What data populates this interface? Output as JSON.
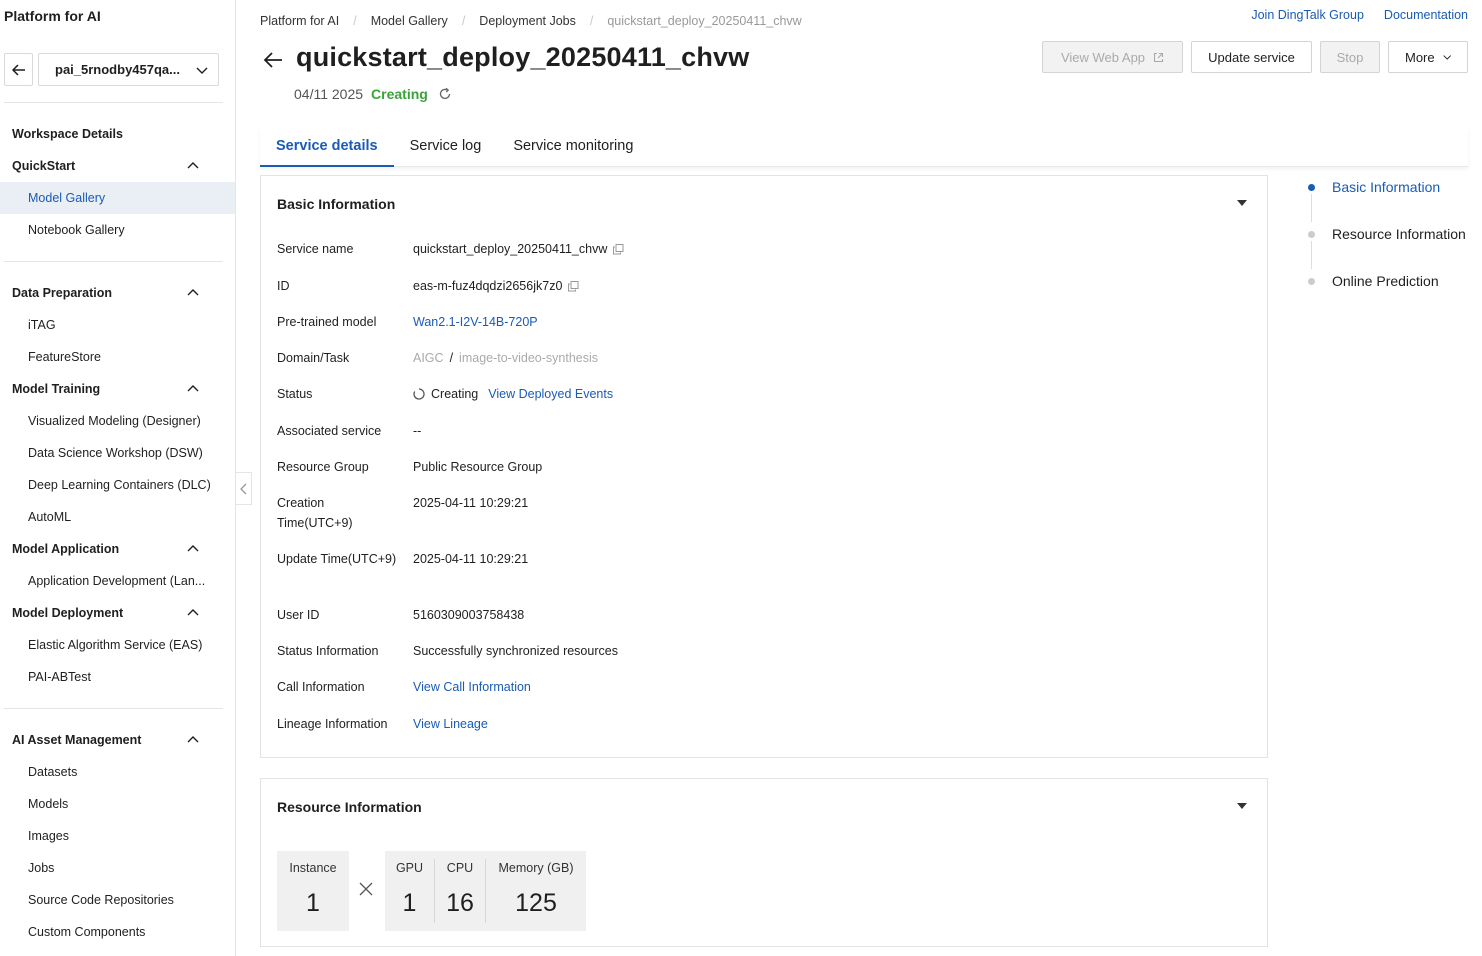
{
  "sidebar": {
    "app_title": "Platform for AI",
    "workspace": "pai_5rnodby457qa...",
    "items": [
      {
        "label": "Workspace Details"
      },
      {
        "label": "QuickStart"
      },
      {
        "label": "Model Gallery"
      },
      {
        "label": "Notebook Gallery"
      },
      {
        "label": "Data Preparation"
      },
      {
        "label": "iTAG"
      },
      {
        "label": "FeatureStore"
      },
      {
        "label": "Model Training"
      },
      {
        "label": "Visualized Modeling (Designer)"
      },
      {
        "label": "Data Science Workshop (DSW)"
      },
      {
        "label": "Deep Learning Containers (DLC)"
      },
      {
        "label": "AutoML"
      },
      {
        "label": "Model Application"
      },
      {
        "label": "Application Development (Lan..."
      },
      {
        "label": "Model Deployment"
      },
      {
        "label": "Elastic Algorithm Service (EAS)"
      },
      {
        "label": "PAI-ABTest"
      },
      {
        "label": "AI Asset Management"
      },
      {
        "label": "Datasets"
      },
      {
        "label": "Models"
      },
      {
        "label": "Images"
      },
      {
        "label": "Jobs"
      },
      {
        "label": "Source Code Repositories"
      },
      {
        "label": "Custom Components"
      }
    ]
  },
  "breadcrumb": [
    "Platform for AI",
    "Model Gallery",
    "Deployment Jobs",
    "quickstart_deploy_20250411_chvw"
  ],
  "toplinks": {
    "dingtalk": "Join DingTalk Group",
    "docs": "Documentation"
  },
  "header": {
    "title": "quickstart_deploy_20250411_chvw",
    "date": "04/11 2025",
    "status": "Creating"
  },
  "actions": {
    "view_web_app": "View Web App",
    "update_service": "Update service",
    "stop": "Stop",
    "more": "More"
  },
  "tabs": [
    "Service details",
    "Service log",
    "Service monitoring"
  ],
  "basic_info": {
    "title": "Basic Information",
    "rows": [
      {
        "label": "Service name",
        "value": "quickstart_deploy_20250411_chvw"
      },
      {
        "label": "ID",
        "value": "eas-m-fuz4dqdzi2656jk7z0"
      },
      {
        "label": "Pre-trained model",
        "value": "Wan2.1-I2V-14B-720P"
      },
      {
        "label": "Domain/Task",
        "value_a": "AIGC",
        "value_sep": "/",
        "value_b": "image-to-video-synthesis"
      },
      {
        "label": "Status",
        "value": "Creating",
        "link": "View Deployed Events"
      },
      {
        "label": "Associated service",
        "value": "--"
      },
      {
        "label": "Resource Group",
        "value": "Public Resource Group"
      },
      {
        "label": "Creation Time(UTC+9)",
        "value": "2025-04-11 10:29:21"
      },
      {
        "label": "Update Time(UTC+9)",
        "value": "2025-04-11 10:29:21"
      },
      {
        "label": "User ID",
        "value": "5160309003758438"
      },
      {
        "label": "Status Information",
        "value": "Successfully synchronized resources"
      },
      {
        "label": "Call Information",
        "value": "View Call Information"
      },
      {
        "label": "Lineage Information",
        "value": "View Lineage"
      }
    ]
  },
  "resource_info": {
    "title": "Resource Information",
    "instance_label": "Instance",
    "instance": "1",
    "gpu_label": "GPU",
    "gpu": "1",
    "cpu_label": "CPU",
    "cpu": "16",
    "memory_label": "Memory (GB)",
    "memory": "125"
  },
  "anchor_nav": [
    "Basic Information",
    "Resource Information",
    "Online Prediction"
  ]
}
